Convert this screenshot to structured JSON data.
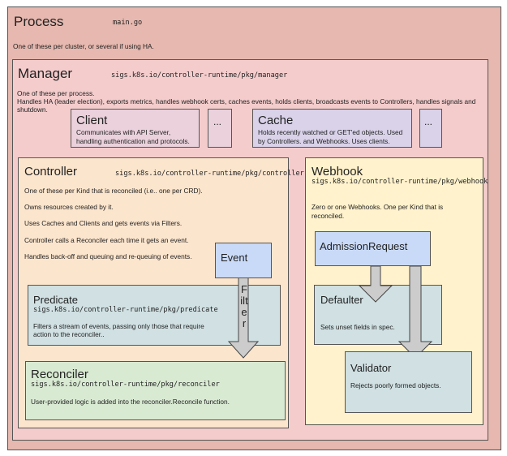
{
  "process": {
    "title": "Process",
    "pkg": "main.go",
    "desc": "One of these per cluster, or several if using HA.",
    "color": "#e6b8af"
  },
  "manager": {
    "title": "Manager",
    "pkg": "sigs.k8s.io/controller-runtime/pkg/manager",
    "desc1": "One of these per process.",
    "desc2": "Handles HA (leader election), exports metrics, handles webhook certs, caches events, holds clients, broadcasts events to Controllers, handles signals and",
    "desc3": "shutdown.",
    "color": "#f4cccc"
  },
  "client": {
    "title": "Client",
    "desc1": "Communicates with API Server,",
    "desc2": "handling authentication and protocols.",
    "more": "...",
    "color": "#ead1dc"
  },
  "cache": {
    "title": "Cache",
    "desc1": "Holds recently watched or GET'ed objects.  Used",
    "desc2": "by Controllers. and Webhooks.  Uses clients.",
    "more": "...",
    "color": "#d9d2e9"
  },
  "controller": {
    "title": "Controller",
    "pkg": "sigs.k8s.io/controller-runtime/pkg/controller",
    "lines": [
      "One of these per Kind that is reconciled (i.e.. one per CRD).",
      "Owns resources created by it.",
      "Uses Caches and Clients and gets events via Filters.",
      "Controller calls a Reconciler each time it gets an event.",
      "Handles back-off and queuing and re-queuing of events."
    ],
    "color": "#fce5cd"
  },
  "event": {
    "title": "Event",
    "color": "#c9daf8"
  },
  "filter": {
    "label": "Filter"
  },
  "predicate": {
    "title": "Predicate",
    "pkg": "sigs.k8s.io/controller-runtime/pkg/predicate",
    "desc1": "Filters a stream of events, passing only those that require",
    "desc2": "action to the reconciler..",
    "color": "#d0e0e3"
  },
  "reconciler": {
    "title": "Reconciler",
    "pkg": "sigs.k8s.io/controller-runtime/pkg/reconciler",
    "desc": "User-provided logic is added into the reconciler.Reconcile function.",
    "color": "#d9ead3"
  },
  "webhook": {
    "title": "Webhook",
    "pkg": "sigs.k8s.io/controller-runtime/pkg/webhook",
    "desc1": "Zero or one Webhooks.  One per Kind that is",
    "desc2": "reconciled.",
    "color": "#fff2cc"
  },
  "admission": {
    "title": "AdmissionRequest",
    "color": "#c9daf8"
  },
  "defaulter": {
    "title": "Defaulter",
    "desc": "Sets unset fields in spec.",
    "color": "#d0e0e3"
  },
  "validator": {
    "title": "Validator",
    "desc": "Rejects poorly formed objects.",
    "color": "#d0e0e3"
  },
  "arrow_color": "#cccccc"
}
